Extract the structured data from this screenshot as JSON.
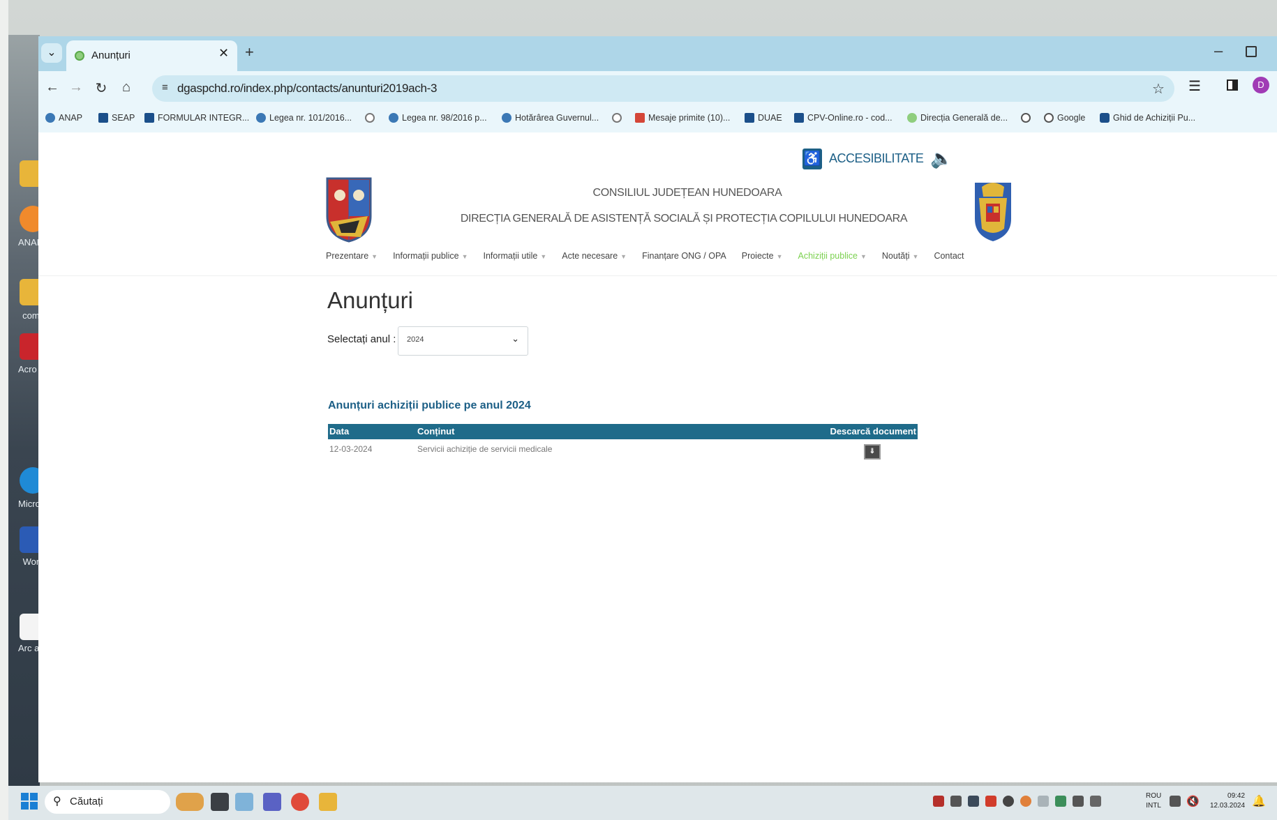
{
  "browser": {
    "tab_title": "Anunțuri",
    "new_tab": "+",
    "url": "dgaspchd.ro/index.php/contacts/anunturi2019ach-3",
    "profile_initial": "D"
  },
  "bookmarks": [
    {
      "label": "ANAP",
      "color": "#3b78b5"
    },
    {
      "label": "SEAP",
      "color": "#1b4f8a"
    },
    {
      "label": "FORMULAR INTEGR...",
      "color": "#1b4f8a"
    },
    {
      "label": "Legea nr. 101/2016...",
      "color": "#3b78b5"
    },
    {
      "label": "",
      "color": "#777777"
    },
    {
      "label": "Legea nr. 98/2016 p...",
      "color": "#3b78b5"
    },
    {
      "label": "Hotărârea Guvernul...",
      "color": "#3b78b5"
    },
    {
      "label": "",
      "color": "#777777"
    },
    {
      "label": "Mesaje primite (10)...",
      "color": "#d44638"
    },
    {
      "label": "DUAE",
      "color": "#1b4f8a"
    },
    {
      "label": "CPV-Online.ro - cod...",
      "color": "#1b4f8a"
    },
    {
      "label": "Direcția Generală de...",
      "color": "#8fce7e"
    },
    {
      "label": "",
      "color": "#555555"
    },
    {
      "label": "Google",
      "color": "#555555"
    },
    {
      "label": "Ghid de Achiziții Pu...",
      "color": "#1b4f8a"
    }
  ],
  "header": {
    "accessibility_label": "ACCESIBILITATE",
    "org_line1": "CONSILIUL JUDEȚEAN HUNEDOARA",
    "org_line2": "DIRECȚIA GENERALĂ DE ASISTENȚĂ SOCIALĂ ȘI PROTECȚIA COPILULUI HUNEDOARA"
  },
  "menu": [
    {
      "label": "Prezentare",
      "dropdown": true
    },
    {
      "label": "Informații publice",
      "dropdown": true
    },
    {
      "label": "Informații utile",
      "dropdown": true
    },
    {
      "label": "Acte necesare",
      "dropdown": true
    },
    {
      "label": "Finanțare ONG / OPA",
      "dropdown": false
    },
    {
      "label": "Proiecte",
      "dropdown": true
    },
    {
      "label": "Achiziții publice",
      "dropdown": true,
      "active": true
    },
    {
      "label": "Noutăți",
      "dropdown": true
    },
    {
      "label": "Contact",
      "dropdown": false
    }
  ],
  "main": {
    "page_title": "Anunțuri",
    "year_label": "Selectați anul :",
    "year_selected": "2024",
    "section_title": "Anunțuri achiziții publice pe anul 2024",
    "table": {
      "headers": [
        "Data",
        "Conținut",
        "Descarcă document"
      ],
      "rows": [
        {
          "date": "12-03-2024",
          "content": "Servicii achiziție de servicii medicale"
        }
      ]
    }
  },
  "desktop_icons": [
    "",
    "ANAF Antiv",
    "",
    "coma",
    "Acro Read",
    "",
    "Micro Ed",
    "Word",
    "",
    "Arc adresa"
  ],
  "taskbar": {
    "search_label": "Căutați",
    "lang_line1": "ROU",
    "lang_line2": "INTL",
    "time": "09:42",
    "date": "12.03.2024"
  },
  "colors": {
    "brand_blue": "#1c5f86",
    "table_header": "#1f6b8a",
    "active_menu": "#7bd14f",
    "tab_bar": "#aed6e8"
  }
}
